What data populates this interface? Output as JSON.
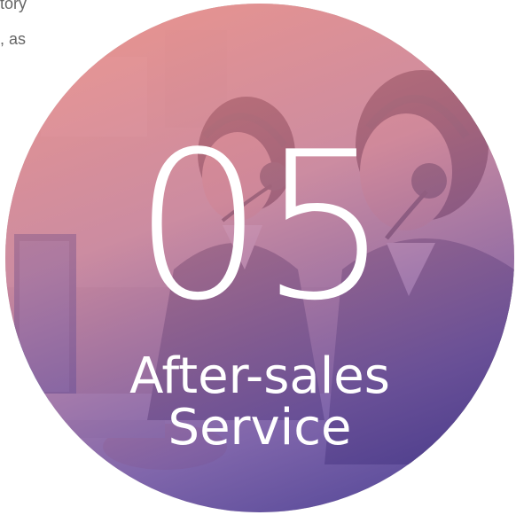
{
  "background_text": {
    "line1": "tory",
    "line2": ", as"
  },
  "card": {
    "number": "05",
    "title_line1": "After-sales",
    "title_line2": "Service"
  },
  "colors": {
    "gradient_top": "#f08c82",
    "gradient_bottom": "#3c328c",
    "text": "#ffffff",
    "background_text": "#666666"
  }
}
